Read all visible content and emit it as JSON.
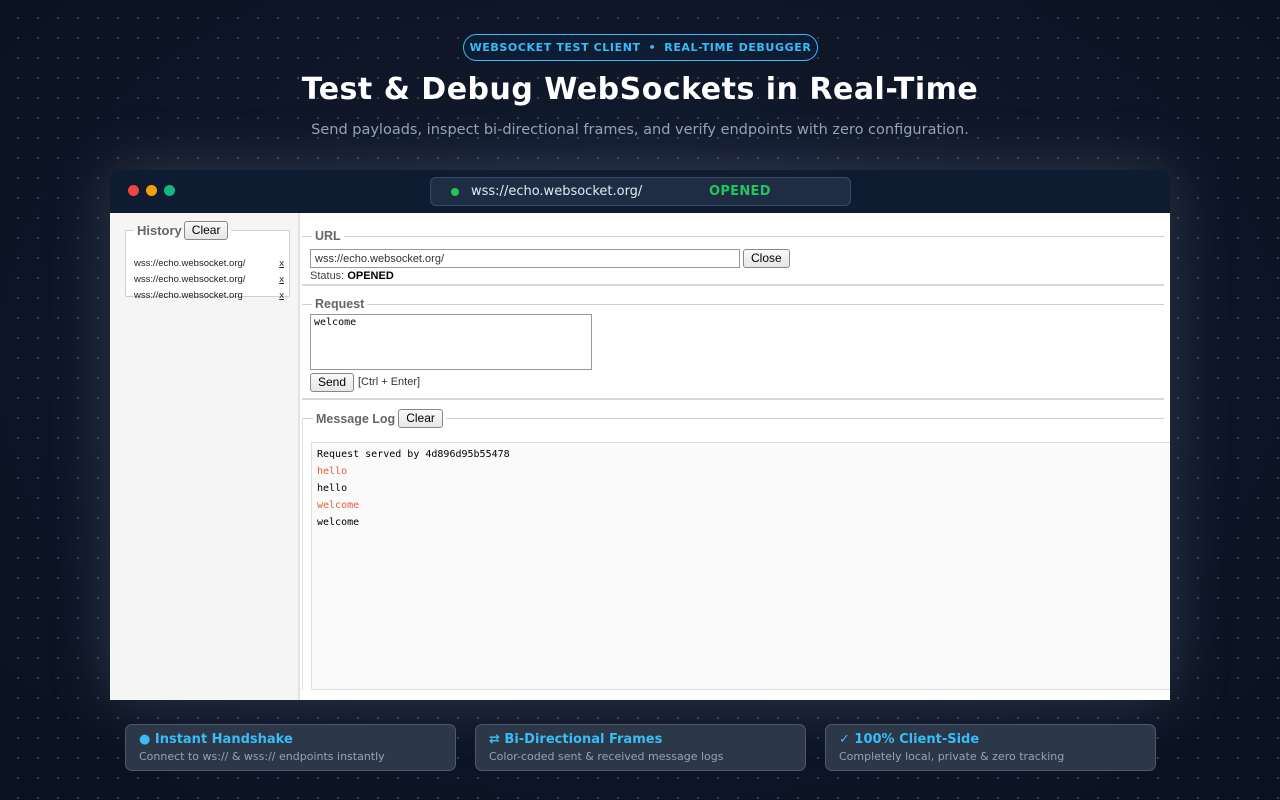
{
  "badge": {
    "left": "WEBSOCKET TEST CLIENT",
    "sep": "•",
    "right": "REAL-TIME DEBUGGER"
  },
  "hero": {
    "title": "Test & Debug WebSockets in Real-Time",
    "subtitle": "Send payloads, inspect bi-directional frames, and verify endpoints with zero configuration."
  },
  "window": {
    "address": "wss://echo.websocket.org/",
    "connection_status": "OPENED"
  },
  "history": {
    "legend": "History",
    "clear_label": "Clear",
    "items": [
      {
        "url": "wss://echo.websocket.org/",
        "remove": "x"
      },
      {
        "url": "wss://echo.websocket.org/",
        "remove": "x"
      },
      {
        "url": "wss://echo.websocket.org",
        "remove": "x"
      }
    ]
  },
  "url_section": {
    "legend": "URL",
    "value": "wss://echo.websocket.org/",
    "close_label": "Close",
    "status_label": "Status:",
    "status_value": "OPENED"
  },
  "request": {
    "legend": "Request",
    "value": "welcome",
    "send_label": "Send",
    "hint": "[Ctrl + Enter]"
  },
  "log": {
    "legend": "Message Log",
    "clear_label": "Clear",
    "lines": [
      {
        "text": "Request served by 4d896d95b55478",
        "kind": "recv"
      },
      {
        "text": "hello",
        "kind": "sent"
      },
      {
        "text": "hello",
        "kind": "recv"
      },
      {
        "text": "welcome",
        "kind": "sent"
      },
      {
        "text": "welcome",
        "kind": "recv"
      }
    ]
  },
  "features": [
    {
      "title": "● Instant Handshake",
      "desc": "Connect to ws:// & wss:// endpoints instantly"
    },
    {
      "title": "⇄ Bi-Directional Frames",
      "desc": "Color-coded sent & received message logs"
    },
    {
      "title": "✓ 100% Client-Side",
      "desc": "Completely local, private & zero tracking"
    }
  ],
  "colors": {
    "accent": "#38bdf8",
    "status_green": "#22c55e",
    "sent_message": "#e85d3a"
  }
}
